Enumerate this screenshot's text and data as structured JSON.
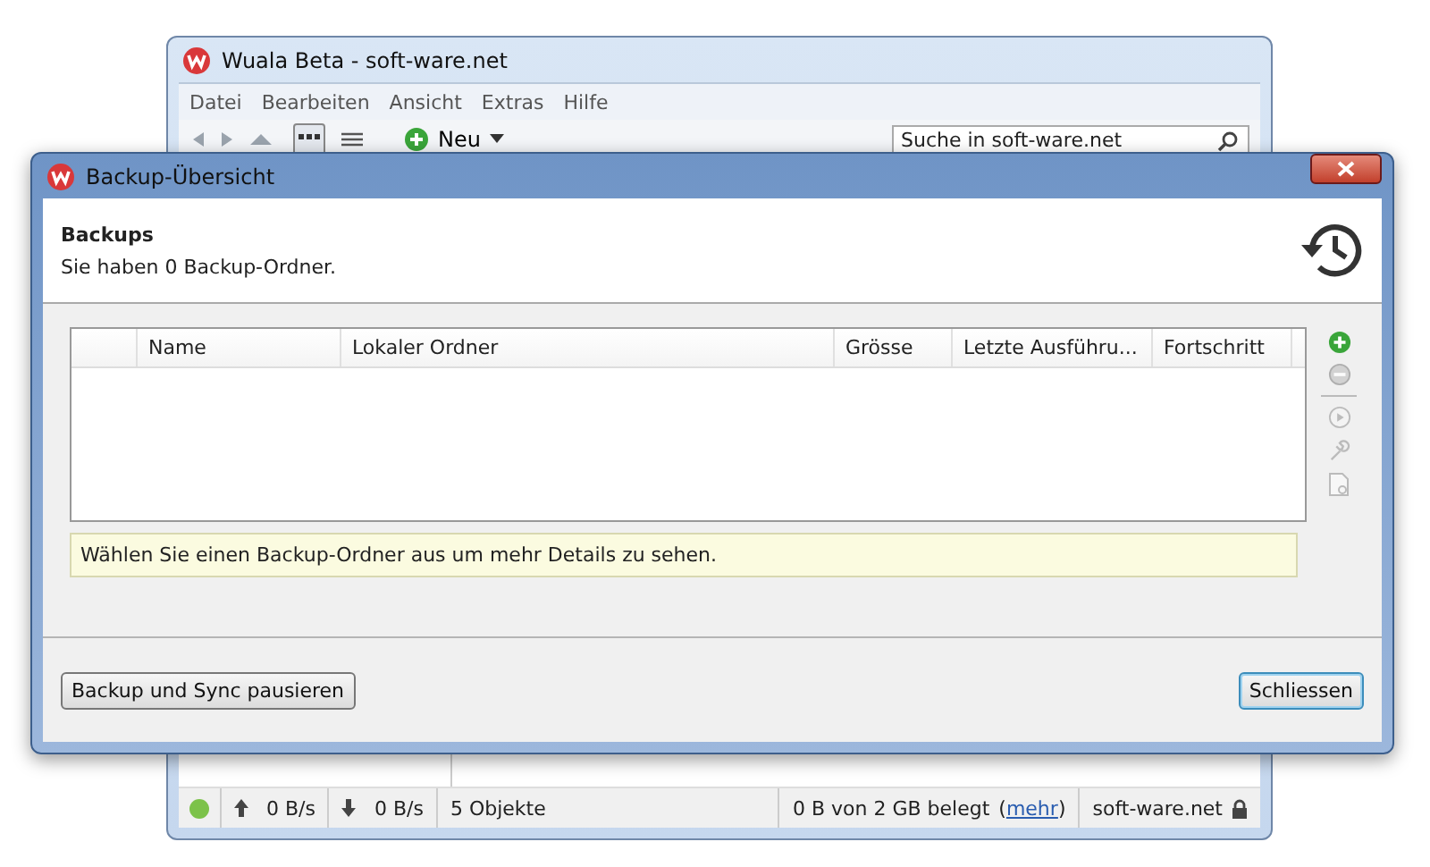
{
  "main_window": {
    "title": "Wuala Beta - soft-ware.net",
    "menu": [
      "Datei",
      "Bearbeiten",
      "Ansicht",
      "Extras",
      "Hilfe"
    ],
    "toolbar": {
      "view_modes": [
        {
          "kind": "grid",
          "selected": true
        },
        {
          "kind": "list",
          "selected": false
        }
      ],
      "new_button": "Neu",
      "search": {
        "placeholder": "Suche in soft-ware.net"
      }
    },
    "status_bar": {
      "online": true,
      "upload": "0 B/s",
      "download": "0 B/s",
      "objects": "5 Objekte",
      "usage": "0 B von 2 GB belegt",
      "usage_open": "(",
      "link": "mehr",
      "usage_close": ")",
      "account": "soft-ware.net"
    }
  },
  "dialog": {
    "title": "Backup-Übersicht",
    "header": {
      "title": "Backups",
      "subtitle": "Sie haben 0 Backup-Ordner."
    },
    "table": {
      "columns": [
        "Name",
        "Lokaler Ordner",
        "Grösse",
        "Letzte Ausführu...",
        "Fortschritt"
      ]
    },
    "tools": [
      {
        "kind": "add",
        "disabled": false
      },
      {
        "kind": "remove",
        "disabled": true
      },
      {
        "kind": "run",
        "disabled": true
      },
      {
        "kind": "settings",
        "disabled": true
      },
      {
        "kind": "log",
        "disabled": true
      }
    ],
    "info": "Wählen Sie einen Backup-Ordner aus um mehr Details zu sehen.",
    "buttons": [
      {
        "label": "Backup und Sync pausieren",
        "default": false
      },
      {
        "label": "Schliessen",
        "default": true
      }
    ]
  }
}
